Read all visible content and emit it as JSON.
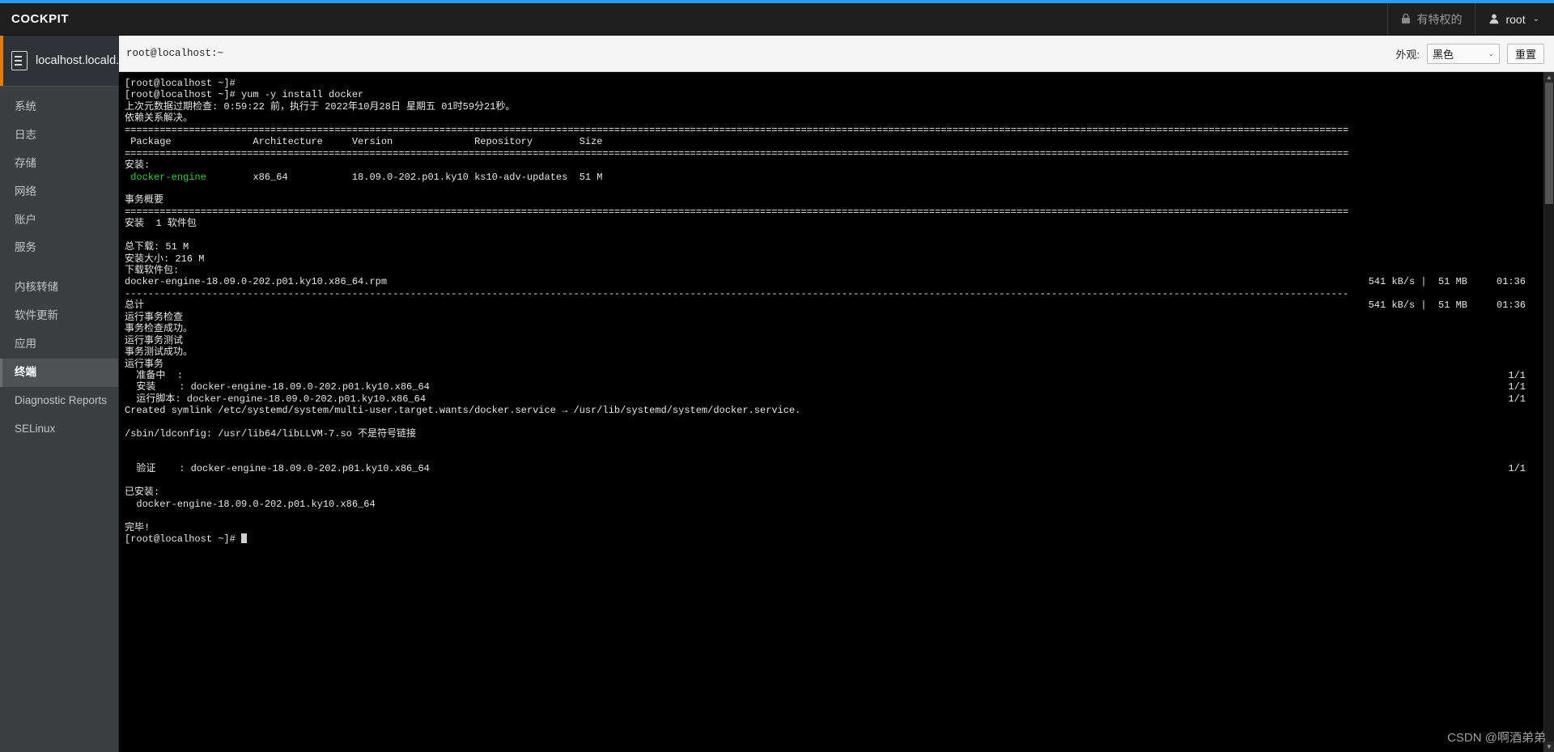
{
  "colors": {
    "accent": "#2b9af3",
    "sidebar_active_marker": "#ec7a08",
    "terminal_green": "#41c441"
  },
  "masthead": {
    "brand": "COCKPIT",
    "privileged_label": "有特权的",
    "privileged_icon": "lock-icon",
    "user_label": "root",
    "user_icon": "user-avatar-icon",
    "caret": "⌄"
  },
  "sidebar": {
    "host": {
      "label": "localhost.locald...",
      "icon": "server-icon"
    },
    "groups": [
      {
        "items": [
          {
            "label": "系统",
            "name": "system",
            "active": false
          },
          {
            "label": "日志",
            "name": "logs",
            "active": false
          },
          {
            "label": "存储",
            "name": "storage",
            "active": false
          },
          {
            "label": "网络",
            "name": "network",
            "active": false
          },
          {
            "label": "账户",
            "name": "accounts",
            "active": false
          },
          {
            "label": "服务",
            "name": "services",
            "active": false
          }
        ]
      },
      {
        "items": [
          {
            "label": "内核转储",
            "name": "kernel-dump",
            "active": false
          },
          {
            "label": "软件更新",
            "name": "software-updates",
            "active": false
          },
          {
            "label": "应用",
            "name": "applications",
            "active": false
          },
          {
            "label": "终端",
            "name": "terminal",
            "active": true
          },
          {
            "label": "Diagnostic Reports",
            "name": "diagnostic-reports",
            "active": false
          },
          {
            "label": "SELinux",
            "name": "selinux",
            "active": false
          }
        ]
      }
    ]
  },
  "terminal_toolbar": {
    "title": "root@localhost:~",
    "theme_label": "外观:",
    "theme_value": "黑色",
    "theme_caret": "⌄",
    "reset_label": "重置"
  },
  "terminal": {
    "lines": [
      {
        "text": "[root@localhost ~]# "
      },
      {
        "text": "[root@localhost ~]# yum -y install docker"
      },
      {
        "text": "上次元数据过期检查: 0:59:22 前，执行于 2022年10月28日 星期五 01时59分21秒。"
      },
      {
        "text": "依赖关系解决。"
      },
      {
        "text": "================================================================================"
      },
      {
        "text": " Package              Architecture     Version              Repository        Size"
      },
      {
        "text": "================================================================================"
      },
      {
        "text": "安装:"
      },
      {
        "text": " docker-engine        x86_64           18.09.0-202.p01.ky10 ks10-adv-updates  51 M",
        "green_start": 1,
        "green_end": 14
      },
      {
        "text": ""
      },
      {
        "text": "事务概要"
      },
      {
        "text": "================================================================================"
      },
      {
        "text": "安装  1 软件包"
      },
      {
        "text": ""
      },
      {
        "text": "总下载: 51 M"
      },
      {
        "text": "安装大小: 216 M"
      },
      {
        "text": "下载软件包:"
      },
      {
        "text": "docker-engine-18.09.0-202.p01.ky10.x86_64.rpm",
        "right": "541 kB/s |  51 MB     01:36"
      },
      {
        "text": "--------------------------------------------------------------------------------",
        "rule": true
      },
      {
        "text": "总计",
        "right": "541 kB/s |  51 MB     01:36"
      },
      {
        "text": "运行事务检查"
      },
      {
        "text": "事务检查成功。"
      },
      {
        "text": "运行事务测试"
      },
      {
        "text": "事务测试成功。"
      },
      {
        "text": "运行事务"
      },
      {
        "text": "  准备中  :",
        "right_small": "1/1"
      },
      {
        "text": "  安装    : docker-engine-18.09.0-202.p01.ky10.x86_64",
        "right_small": "1/1"
      },
      {
        "text": "  运行脚本: docker-engine-18.09.0-202.p01.ky10.x86_64",
        "right_small": "1/1"
      },
      {
        "text": "Created symlink /etc/systemd/system/multi-user.target.wants/docker.service → /usr/lib/systemd/system/docker.service."
      },
      {
        "text": ""
      },
      {
        "text": "/sbin/ldconfig: /usr/lib64/libLLVM-7.so 不是符号链接"
      },
      {
        "text": ""
      },
      {
        "text": ""
      },
      {
        "text": "  验证    : docker-engine-18.09.0-202.p01.ky10.x86_64",
        "right_small": "1/1"
      },
      {
        "text": ""
      },
      {
        "text": "已安装:"
      },
      {
        "text": "  docker-engine-18.09.0-202.p01.ky10.x86_64"
      },
      {
        "text": ""
      },
      {
        "text": "完毕!"
      },
      {
        "text": "[root@localhost ~]# ",
        "cursor": true
      }
    ],
    "table_header": {
      "package": "Package",
      "architecture": "Architecture",
      "version": "Version",
      "repository": "Repository",
      "size": "Size"
    },
    "package_row": {
      "name": "docker-engine",
      "architecture": "x86_64",
      "version": "18.09.0-202.p01.ky10",
      "repository": "ks10-adv-updates",
      "size": "51 M"
    },
    "transfer": {
      "speed": "541 kB/s",
      "total": "51 MB",
      "time": "01:36"
    },
    "progress_counter": "1/1"
  },
  "scrollbar": {
    "up_glyph": "▲",
    "down_glyph": "▼"
  },
  "watermark": "CSDN @啊酒弟弟"
}
